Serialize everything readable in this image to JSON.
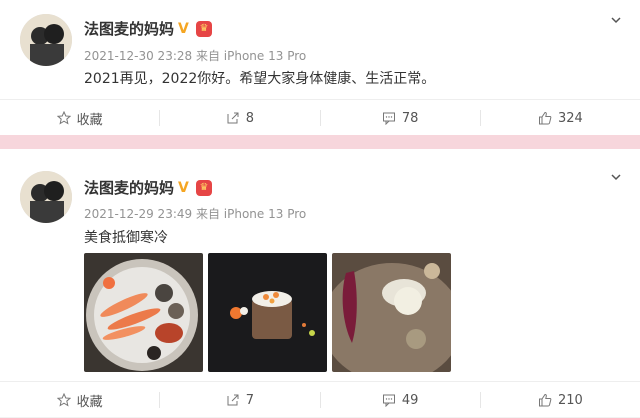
{
  "posts": [
    {
      "user": "法图麦的妈妈",
      "time": "2021-12-30 23:28",
      "source": "来自 iPhone 13 Pro",
      "text": "2021再见，2022你好。希望大家身体健康、生活正常。",
      "actions": {
        "fav": "收藏",
        "repost": "8",
        "comment": "78",
        "like": "324"
      }
    },
    {
      "user": "法图麦的妈妈",
      "time": "2021-12-29 23:49",
      "source": "来自 iPhone 13 Pro",
      "text": "美食抵御寒冷",
      "actions": {
        "fav": "收藏",
        "repost": "7",
        "comment": "49",
        "like": "210"
      }
    }
  ],
  "colors": {
    "divider": "#f7d6dc",
    "vip": "#f5a623"
  },
  "icons": [
    "star-icon",
    "share-icon",
    "comment-icon",
    "like-icon",
    "chevron-down-icon",
    "verified-icon",
    "crown-icon"
  ]
}
